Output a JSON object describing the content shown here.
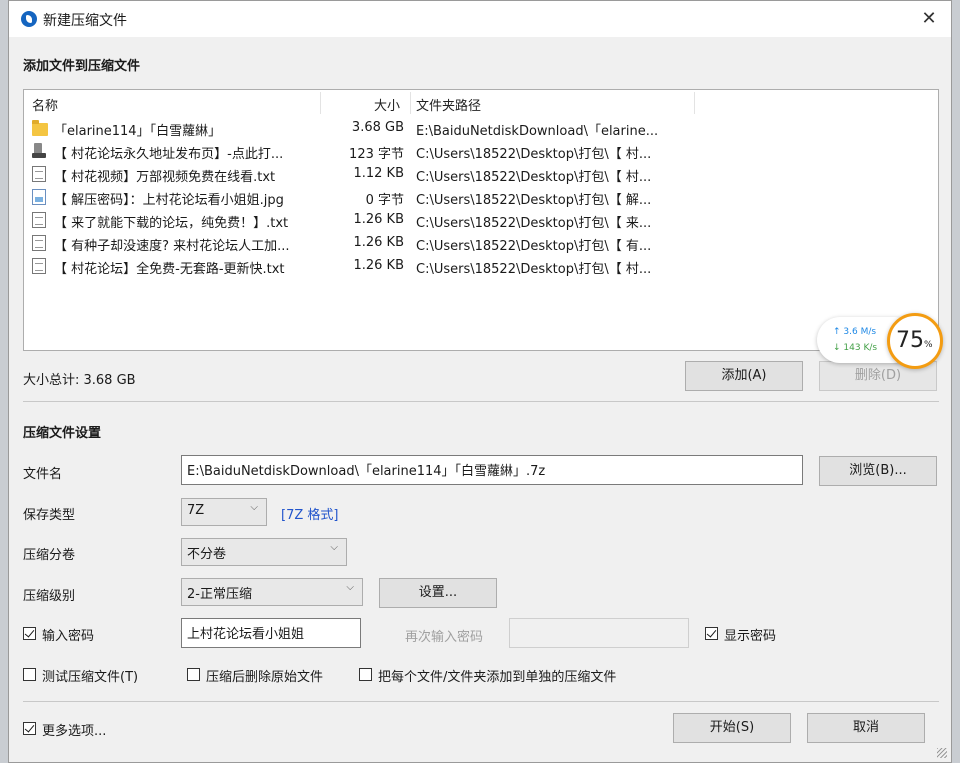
{
  "window": {
    "title": "新建压缩文件",
    "close_glyph": "✕"
  },
  "add_section": {
    "title": "添加文件到压缩文件",
    "columns": {
      "name": "名称",
      "size": "大小",
      "path": "文件夹路径"
    },
    "files": [
      {
        "icon": "folder-icon",
        "name": "「elarine114」「白雪蘿綝」",
        "size": "3.68 GB",
        "path": "E:\\BaiduNetdiskDownload\\「elarine..."
      },
      {
        "icon": "shortcut-file-icon",
        "name": "【 村花论坛永久地址发布页】-点此打...",
        "size": "123 字节",
        "path": "C:\\Users\\18522\\Desktop\\打包\\【 村..."
      },
      {
        "icon": "text-file-icon",
        "name": "【 村花视频】万部视频免费在线看.txt",
        "size": "1.12 KB",
        "path": "C:\\Users\\18522\\Desktop\\打包\\【 村..."
      },
      {
        "icon": "image-file-icon",
        "name": "【 解压密码】：上村花论坛看小姐姐.jpg",
        "size": "0 字节",
        "path": "C:\\Users\\18522\\Desktop\\打包\\【 解..."
      },
      {
        "icon": "text-file-icon",
        "name": "【 来了就能下载的论坛，纯免费！】.txt",
        "size": "1.26 KB",
        "path": "C:\\Users\\18522\\Desktop\\打包\\【 来..."
      },
      {
        "icon": "text-file-icon",
        "name": "【 有种子却没速度? 来村花论坛人工加...",
        "size": "1.26 KB",
        "path": "C:\\Users\\18522\\Desktop\\打包\\【 有..."
      },
      {
        "icon": "text-file-icon",
        "name": "【 村花论坛】全免费-无套路-更新快.txt",
        "size": "1.26 KB",
        "path": "C:\\Users\\18522\\Desktop\\打包\\【 村..."
      }
    ],
    "total_label": "大小总计: 3.68 GB",
    "add_button": "添加(A)",
    "remove_button": "删除(D)"
  },
  "speed_widget": {
    "up": "↑ 3.6 M/s",
    "down": "↓ 143 K/s",
    "percent": "75",
    "percent_sign": "%",
    "gauge_color": "#f39c12"
  },
  "settings": {
    "title": "压缩文件设置",
    "filename_label": "文件名",
    "filename_value": "E:\\BaiduNetdiskDownload\\「elarine114」「白雪蘿綝」.7z",
    "browse_button": "浏览(B)...",
    "type_label": "保存类型",
    "type_value": "7Z",
    "type_format": "[7Z 格式]",
    "split_label": "压缩分卷",
    "split_value": "不分卷",
    "level_label": "压缩级别",
    "level_value": "2-正常压缩",
    "settings_button": "设置...",
    "password_label": "输入密码",
    "password_checked": true,
    "password_value": "上村花论坛看小姐姐",
    "password_again_label": "再次输入密码",
    "password_again_value": "",
    "show_password_label": "显示密码",
    "show_password_checked": true,
    "test_label": "测试压缩文件(T)",
    "delete_after_label": "压缩后删除原始文件",
    "separate_label": "把每个文件/文件夹添加到单独的压缩文件"
  },
  "footer": {
    "more_options_label": "更多选项...",
    "start_button": "开始(S)",
    "cancel_button": "取消"
  },
  "colors": {
    "accent": "#1565c0",
    "link": "#2255cc"
  }
}
